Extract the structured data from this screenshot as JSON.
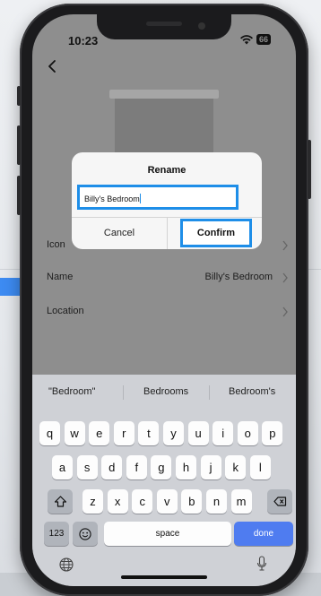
{
  "status_bar": {
    "time": "10:23",
    "battery": "66"
  },
  "device_settings": {
    "rows": [
      {
        "label": "Icon",
        "value": ""
      },
      {
        "label": "Name",
        "value": "Billy's Bedroom"
      },
      {
        "label": "Location",
        "value": ""
      }
    ]
  },
  "rename_dialog": {
    "title": "Rename",
    "input_value": "Billy's Bedroom",
    "cancel_label": "Cancel",
    "confirm_label": "Confirm",
    "highlight_color": "#1e8ee8"
  },
  "keyboard": {
    "suggestions": [
      "\"Bedroom\"",
      "Bedrooms",
      "Bedroom's"
    ],
    "row1": [
      "q",
      "w",
      "e",
      "r",
      "t",
      "y",
      "u",
      "i",
      "o",
      "p"
    ],
    "row2": [
      "a",
      "s",
      "d",
      "f",
      "g",
      "h",
      "j",
      "k",
      "l"
    ],
    "row3": [
      "z",
      "x",
      "c",
      "v",
      "b",
      "n",
      "m"
    ],
    "numbers_label": "123",
    "space_label": "space",
    "done_label": "done",
    "done_color": "#4f7cf0"
  }
}
